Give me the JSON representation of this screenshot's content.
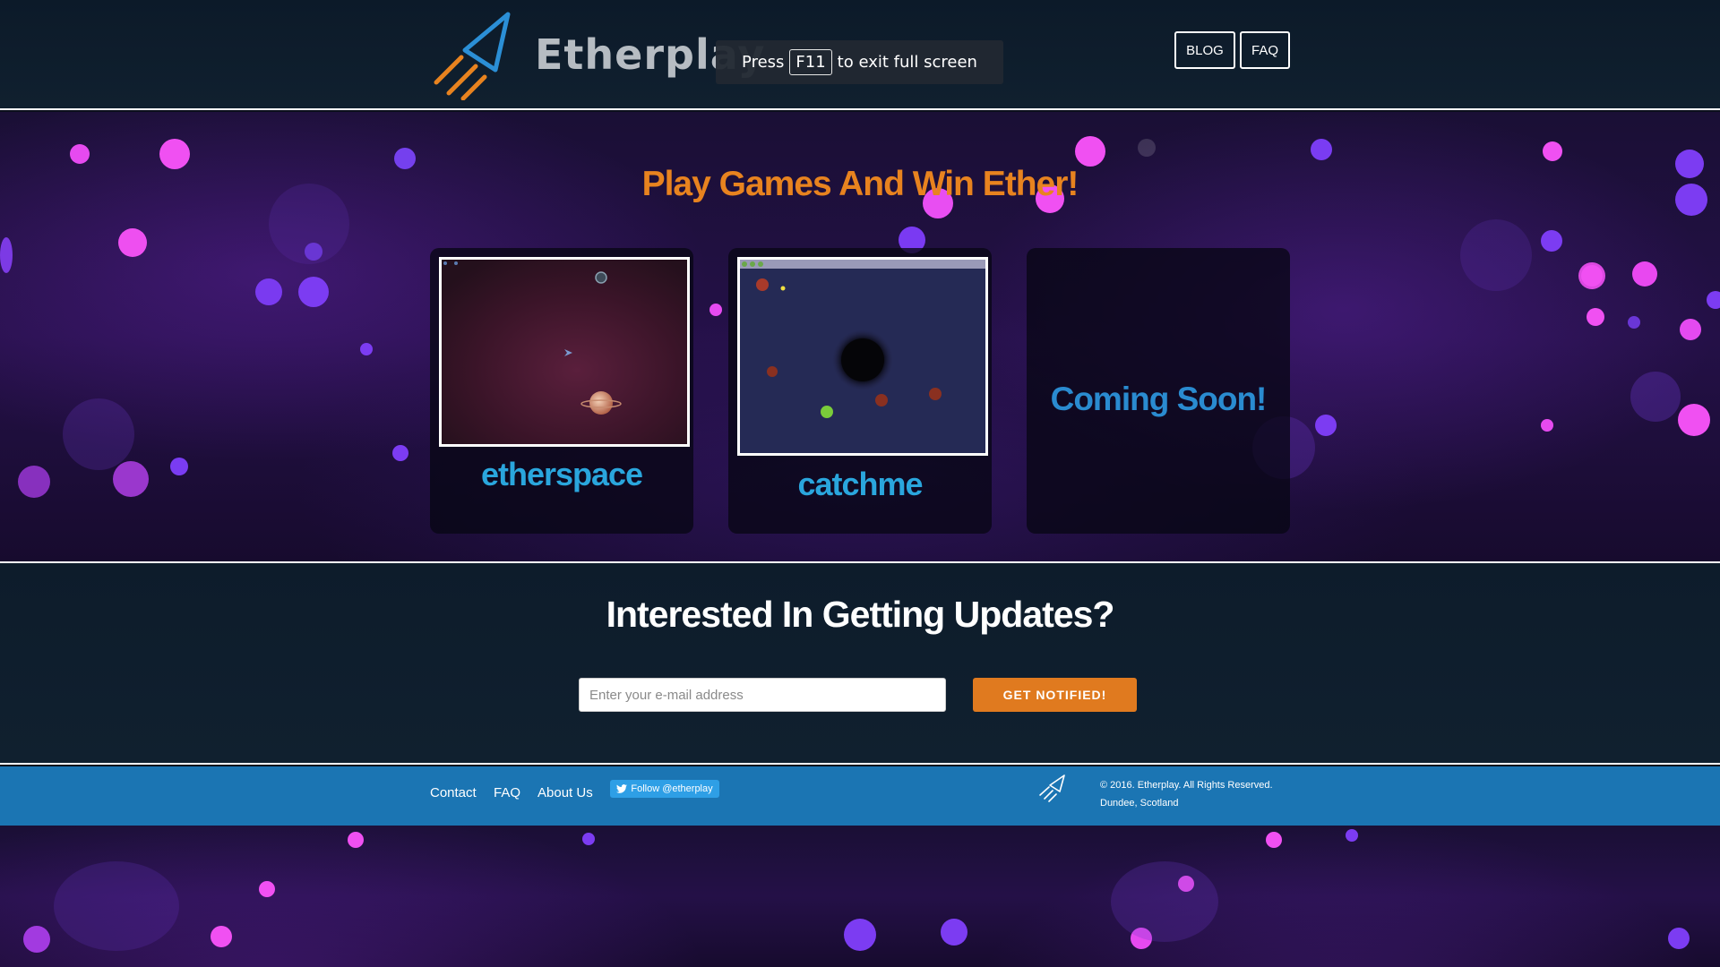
{
  "header": {
    "brand": "Etherplay",
    "fullscreen_notice": {
      "press": "Press",
      "key": "F11",
      "rest": "to exit full screen"
    },
    "nav": {
      "blog": "BLOG",
      "faq": "FAQ"
    }
  },
  "hero": {
    "title": "Play Games And Win Ether!",
    "games": [
      {
        "name": "etherspace"
      },
      {
        "name": "catchme"
      }
    ],
    "coming_soon": "Coming Soon!"
  },
  "updates": {
    "title": "Interested In Getting Updates?",
    "email_placeholder": "Enter your e-mail address",
    "button": "GET NOTIFIED!"
  },
  "footer": {
    "links": [
      "Contact",
      "FAQ",
      "About Us"
    ],
    "twitter": "Follow @etherplay",
    "copyright": "© 2016. Etherplay. All Rights Reserved.",
    "location": "Dundee, Scotland"
  },
  "colors": {
    "accent_orange": "#e8831f",
    "game_title_blue": "#2aa6dd",
    "footer_blue": "#1b75b3",
    "header_bg": "#0c1a29"
  },
  "icons": {
    "logo": "rocket-icon",
    "twitter": "twitter-bird-icon"
  }
}
